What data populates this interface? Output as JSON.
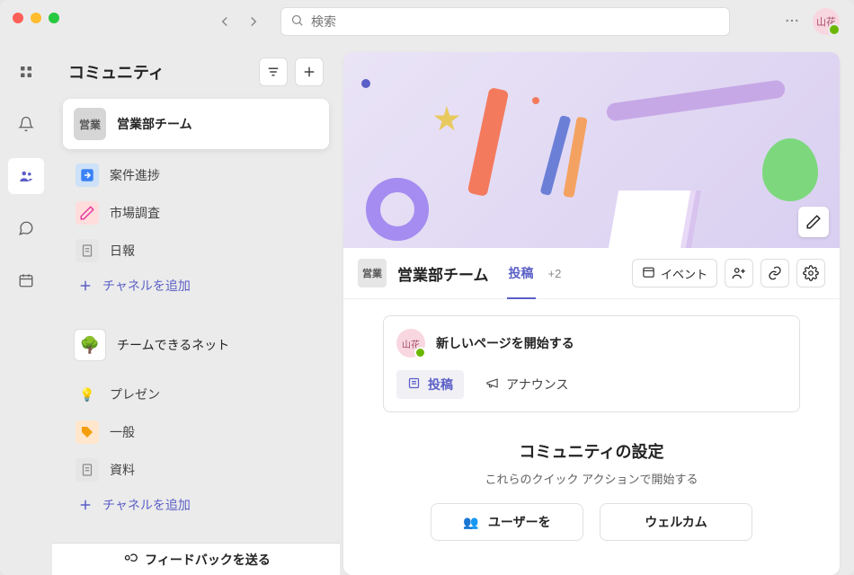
{
  "topbar": {
    "search_placeholder": "検索"
  },
  "user": {
    "initials": "山花"
  },
  "panel": {
    "title": "コミュニティ"
  },
  "communities": [
    {
      "badge": "営業",
      "label": "営業部チーム",
      "channels": [
        {
          "label": "案件進捗"
        },
        {
          "label": "市場調査"
        },
        {
          "label": "日報"
        }
      ],
      "add_channel": "チャネルを追加"
    },
    {
      "badge": "tree",
      "label": "チームできるネット",
      "channels": [
        {
          "label": "プレゼン"
        },
        {
          "label": "一般"
        },
        {
          "label": "資料"
        }
      ],
      "add_channel": "チャネルを追加"
    }
  ],
  "feedback_label": "フィードバックを送る",
  "content": {
    "badge": "営業",
    "title": "営業部チーム",
    "tabs": {
      "post": "投稿",
      "extra": "+2"
    },
    "events_btn": "イベント",
    "composer": {
      "placeholder": "新しいページを開始する",
      "post_btn": "投稿",
      "announce_btn": "アナウンス"
    },
    "settings": {
      "title": "コミュニティの設定",
      "subtitle": "これらのクイック アクションで開始する",
      "card_users": "ユーザーを",
      "card_welcome": "ウェルカム"
    }
  }
}
